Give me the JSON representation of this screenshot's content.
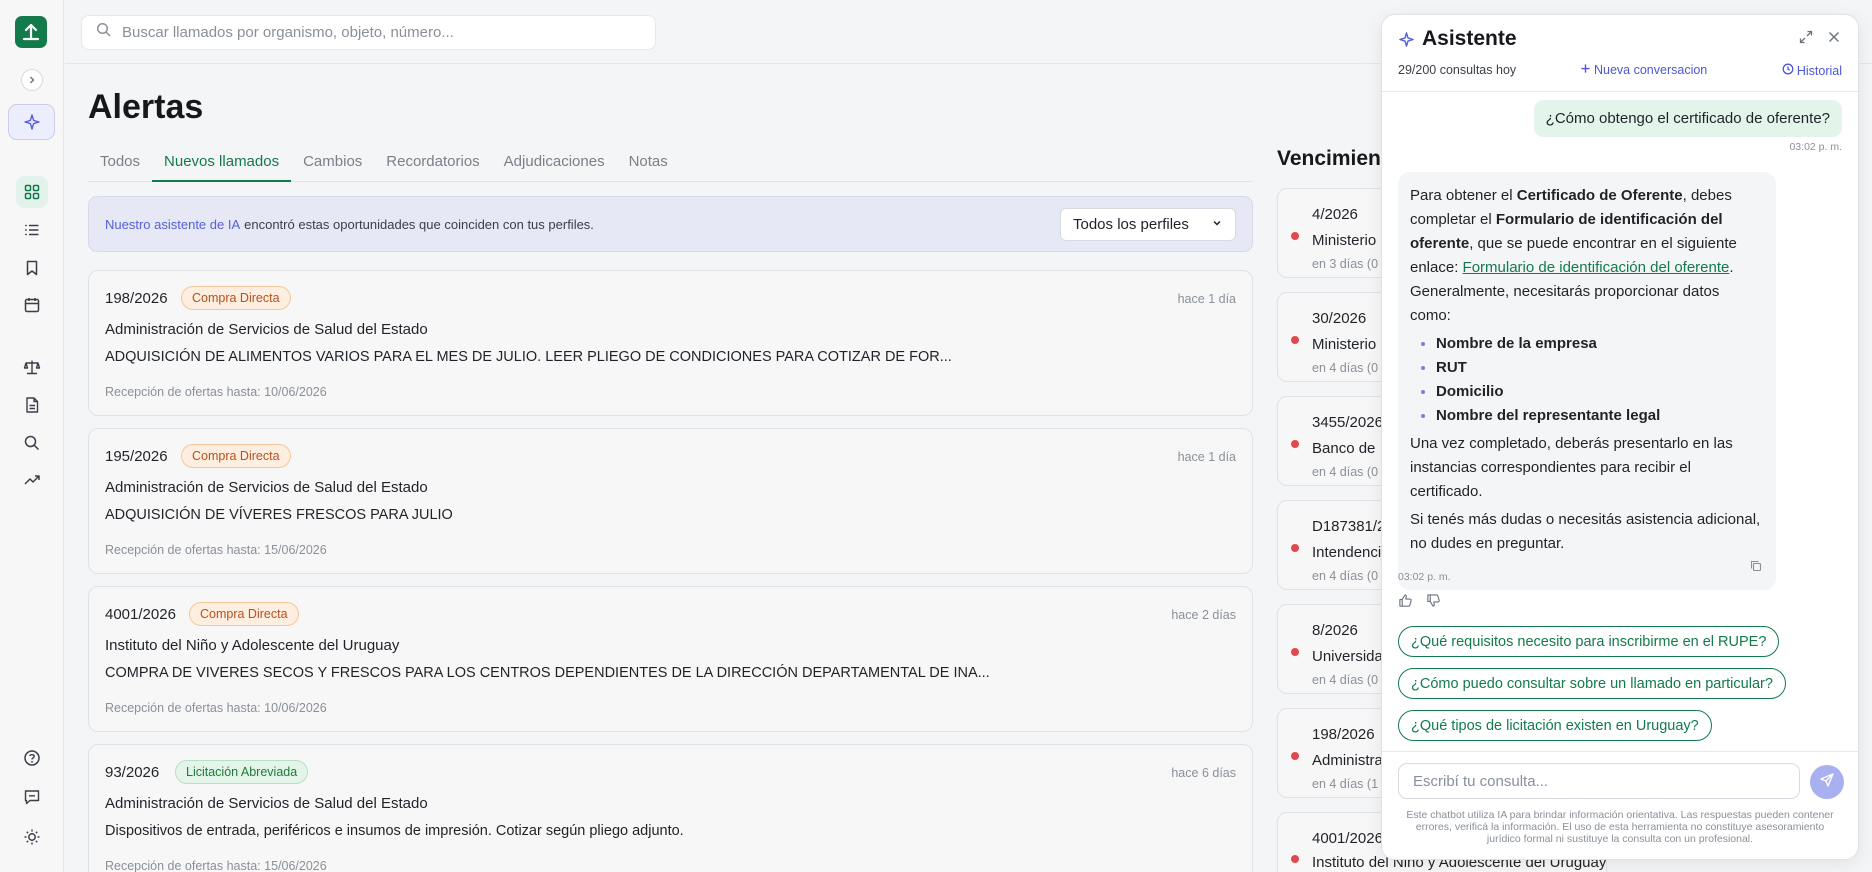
{
  "search": {
    "placeholder": "Buscar llamados por organismo, objeto, número..."
  },
  "sidebar": {
    "icons": [
      "logo-icon",
      "chevron-right-icon",
      "sparkle-icon",
      "grid-icon",
      "list-icon",
      "bookmark-icon",
      "calendar-icon",
      "scale-icon",
      "document-icon",
      "search-icon",
      "trend-icon",
      "help-icon",
      "feedback-icon",
      "theme-icon"
    ]
  },
  "page": {
    "title": "Alertas"
  },
  "tabs": [
    {
      "label": "Todos"
    },
    {
      "label": "Nuevos llamados",
      "active": true
    },
    {
      "label": "Cambios"
    },
    {
      "label": "Recordatorios"
    },
    {
      "label": "Adjudicaciones"
    },
    {
      "label": "Notas"
    }
  ],
  "banner": {
    "highlight": "Nuestro asistente de IA",
    "text": "encontró estas oportunidades que coinciden con tus perfiles.",
    "filter": "Todos los perfiles"
  },
  "cards": [
    {
      "number": "198/2026",
      "badge": "Compra Directa",
      "time": "hace 1 día",
      "org": "Administración de Servicios de Salud del Estado",
      "desc": "ADQUISICIÓN DE ALIMENTOS VARIOS PARA EL MES DE JULIO. LEER PLIEGO DE CONDICIONES PARA COTIZAR DE FOR...",
      "deadline": "Recepción de ofertas hasta: 10/06/2026"
    },
    {
      "number": "195/2026",
      "badge": "Compra Directa",
      "time": "hace 1 día",
      "org": "Administración de Servicios de Salud del Estado",
      "desc": "ADQUISICIÓN DE VÍVERES FRESCOS PARA JULIO",
      "deadline": "Recepción de ofertas hasta: 15/06/2026"
    },
    {
      "number": "4001/2026",
      "badge": "Compra Directa",
      "time": "hace 2 días",
      "org": "Instituto del Niño y Adolescente del Uruguay",
      "desc": "COMPRA DE VIVERES SECOS Y FRESCOS PARA LOS CENTROS DEPENDIENTES DE LA DIRECCIÓN DEPARTAMENTAL DE INA...",
      "deadline": "Recepción de ofertas hasta: 10/06/2026"
    },
    {
      "number": "93/2026",
      "badge": "Licitación Abreviada",
      "time": "hace 6 días",
      "org": "Administración de Servicios de Salud del Estado",
      "desc": "Dispositivos de entrada, periféricos e insumos de impresión. Cotizar según pliego adjunto.",
      "deadline": "Recepción de ofertas hasta: 15/06/2026"
    }
  ],
  "vencimientos": {
    "title": "Vencimient",
    "items": [
      {
        "number": "4/2026",
        "org": "Ministerio",
        "days": "en 3 días (0"
      },
      {
        "number": "30/2026",
        "org": "Ministerio",
        "days": "en 4 días (0"
      },
      {
        "number": "3455/2026",
        "org": "Banco de",
        "days": "en 4 días (0"
      },
      {
        "number": "D187381/2",
        "org": "Intendenci",
        "days": "en 4 días (0"
      },
      {
        "number": "8/2026",
        "org": "Universida",
        "days": "en 4 días (0"
      },
      {
        "number": "198/2026",
        "org": "Administra",
        "days": "en 4 días (1"
      },
      {
        "number": "4001/2026",
        "org": "Instituto del Niño y Adolescente del Uruguay",
        "days": ""
      }
    ]
  },
  "assistant": {
    "title": "Asistente",
    "usage": "29/200 consultas hoy",
    "new_label": "Nueva conversacion",
    "history_label": "Historial",
    "user_message": "¿Cómo obtengo el certificado de oferente?",
    "user_time": "03:02 p. m.",
    "answer": {
      "p1_a": "Para obtener el ",
      "p1_b": "Certificado de Oferente",
      "p1_c": ", debes completar el ",
      "p1_d": "Formulario de identificación del oferente",
      "p1_e": ", que se puede encontrar en el siguiente enlace: ",
      "p1_link": "Formulario de identificación del oferente",
      "p1_f": ". Generalmente, necesitarás proporcionar datos como:",
      "items": [
        "Nombre de la empresa",
        "RUT",
        "Domicilio",
        "Nombre del representante legal"
      ],
      "p2": "Una vez completado, deberás presentarlo en las instancias correspondientes para recibir el certificado.",
      "p3": "Si tenés más dudas o necesitás asistencia adicional, no dudes en preguntar."
    },
    "answer_time": "03:02 p. m.",
    "suggestions": [
      "¿Qué requisitos necesito para inscribirme en el RUPE?",
      "¿Cómo puedo consultar sobre un llamado en particular?",
      "¿Qué tipos de licitación existen en Uruguay?"
    ],
    "input_placeholder": "Escribí tu consulta...",
    "disclaimer": "Este chatbot utiliza IA para brindar información orientativa. Las respuestas pueden contener errores, verificá la información. El uso de esta herramienta no constituye asesoramiento jurídico formal ni sustituye la consulta con un profesional."
  },
  "colors": {
    "brand": "#137a4c",
    "accent": "#4b57d6",
    "danger": "#e0484d"
  }
}
